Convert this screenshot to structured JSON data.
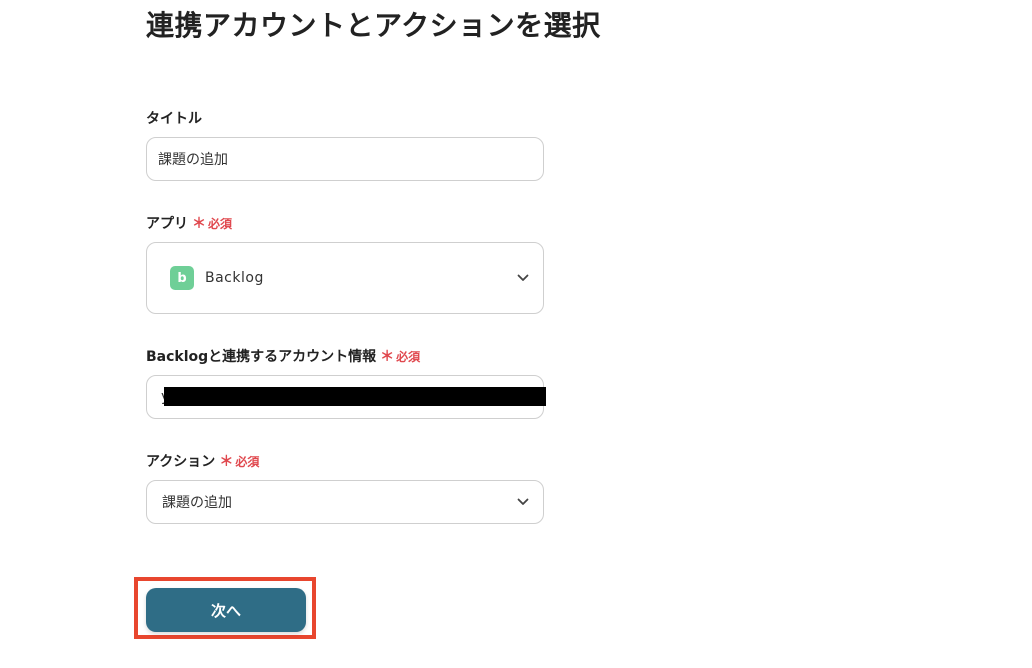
{
  "page": {
    "title": "連携アカウントとアクションを選択"
  },
  "form": {
    "title_field": {
      "label": "タイトル",
      "value": "課題の追加"
    },
    "app_field": {
      "label": "アプリ",
      "required_mark": "＊",
      "required_text": "必須",
      "selected_app": "Backlog",
      "app_icon_letter": "b",
      "app_icon_color": "#6fcf97"
    },
    "account_field": {
      "label": "Backlogと連携するアカウント情報",
      "required_mark": "＊",
      "required_text": "必須",
      "value_prefix": "y"
    },
    "action_field": {
      "label": "アクション",
      "required_mark": "＊",
      "required_text": "必須",
      "selected_action": "課題の追加"
    }
  },
  "buttons": {
    "next_label": "次へ"
  },
  "colors": {
    "required": "#e0484e",
    "primary_button": "#2f6d86",
    "highlight_frame": "#e8462e"
  }
}
